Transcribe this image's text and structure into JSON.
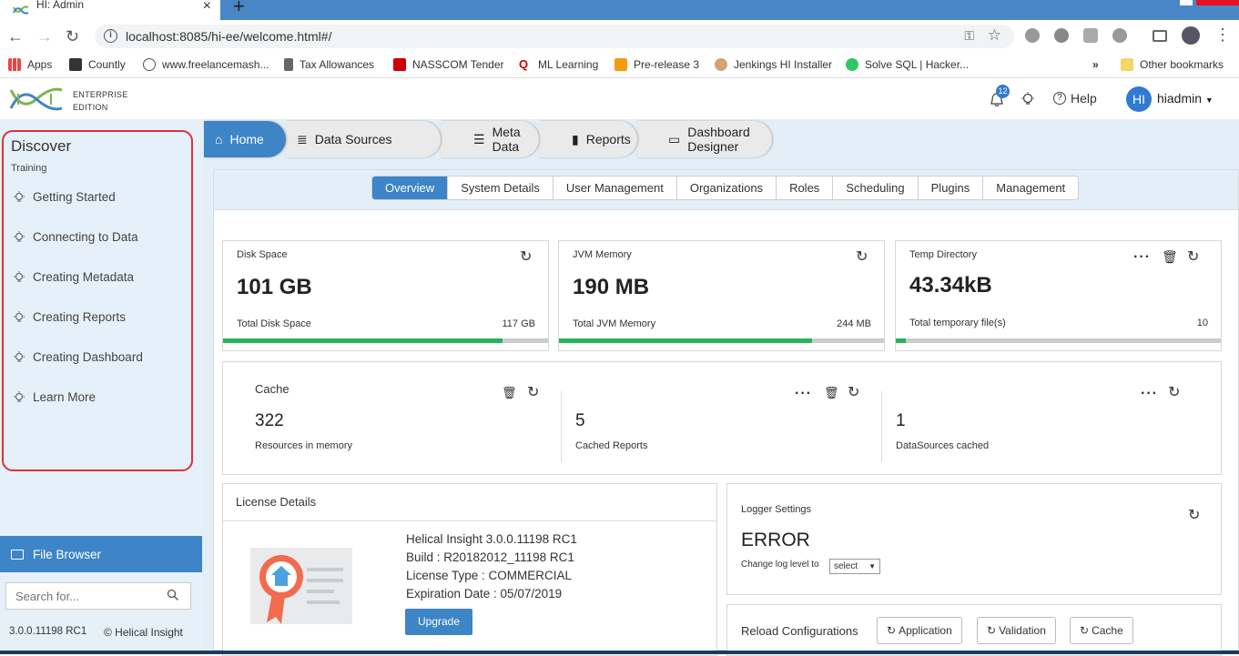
{
  "browser": {
    "tab_title": "HI: Admin",
    "url": "localhost:8085/hi-ee/welcome.html#/",
    "bookmarks": [
      "Apps",
      "Countly",
      "www.freelancemash...",
      "Tax Allowances",
      "NASSCOM Tender",
      "ML Learning",
      "Pre-release 3",
      "Jenkings HI Installer",
      "Solve SQL | Hacker..."
    ],
    "bookmarks_more": "»",
    "other_bookmarks": "Other bookmarks"
  },
  "header": {
    "logo_line1": "ENTERPRISE",
    "logo_line2": "EDITION",
    "notification_count": "12",
    "help_label": "Help",
    "avatar_initials": "HI",
    "username": "hiadmin"
  },
  "sidebar": {
    "discover_title": "Discover",
    "discover_sub": "Training",
    "items": [
      "Getting Started",
      "Connecting to Data",
      "Creating Metadata",
      "Creating Reports",
      "Creating Dashboard",
      "Learn More"
    ],
    "file_browser": "File Browser",
    "search_placeholder": "Search for...",
    "version": "3.0.0.11198 RC1",
    "copyright": "© Helical Insight"
  },
  "nav": {
    "tabs": [
      "Home",
      "Data Sources",
      "Meta Data",
      "Reports",
      "Dashboard Designer"
    ]
  },
  "subtabs": [
    "Overview",
    "System Details",
    "User Management",
    "Organizations",
    "Roles",
    "Scheduling",
    "Plugins",
    "Management"
  ],
  "disk": {
    "label": "Disk Space",
    "value": "101 GB",
    "foot_label": "Total Disk Space",
    "foot_value": "117 GB",
    "fill_pct": 86
  },
  "jvm": {
    "label": "JVM Memory",
    "value": "190 MB",
    "foot_label": "Total JVM Memory",
    "foot_value": "244 MB",
    "fill_pct": 78
  },
  "temp": {
    "label": "Temp Directory",
    "value": "43.34kB",
    "foot_label": "Total temporary file(s)",
    "foot_value": "10",
    "fill_pct": 3
  },
  "cache": {
    "title": "Cache",
    "resources_value": "322",
    "resources_label": "Resources in memory",
    "reports_value": "5",
    "reports_label": "Cached Reports",
    "ds_value": "1",
    "ds_label": "DataSources cached"
  },
  "license": {
    "title": "License Details",
    "product": "Helical Insight 3.0.0.11198 RC1",
    "build": "Build : R20182012_11198 RC1",
    "type": "License Type : COMMERCIAL",
    "expiration": "Expiration Date : 05/07/2019",
    "upgrade": "Upgrade"
  },
  "logger": {
    "title": "Logger Settings",
    "level": "ERROR",
    "change_label": "Change log level to",
    "select_value": "select"
  },
  "reload": {
    "title": "Reload Configurations",
    "buttons": [
      "Application",
      "Validation",
      "Cache"
    ]
  },
  "colors": {
    "accent": "#3d85c6",
    "progress": "#27b35c",
    "sidebar_bg": "#e6f0f8",
    "highlight": "#e0303a"
  }
}
